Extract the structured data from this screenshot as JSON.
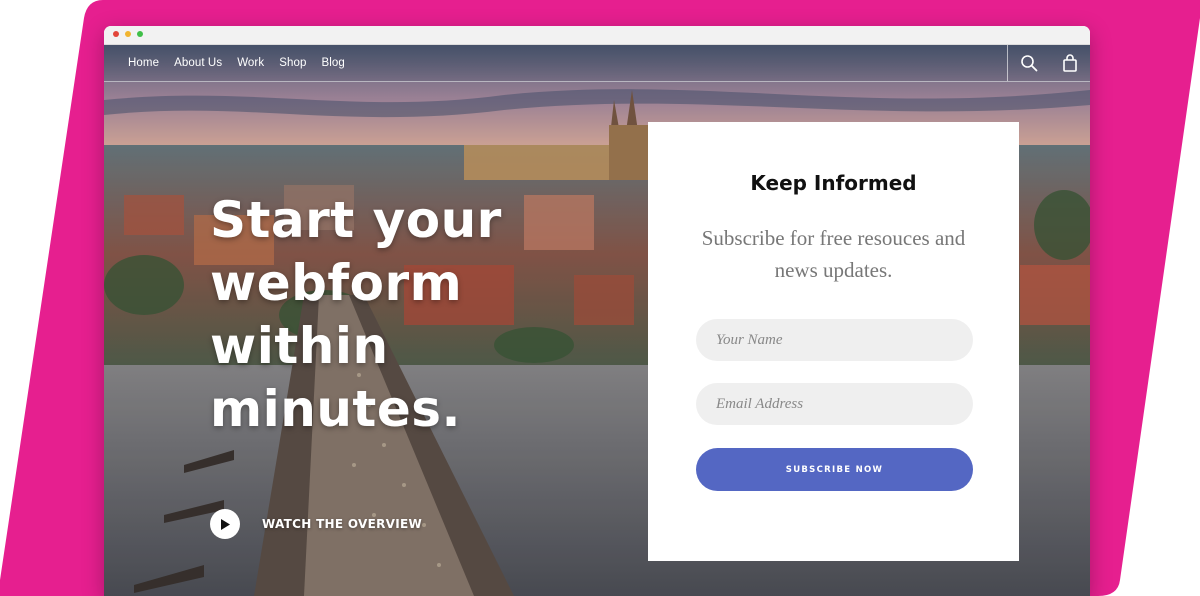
{
  "colors": {
    "backdrop": "#e61f8f",
    "accent": "#5467c3"
  },
  "nav": {
    "links": [
      "Home",
      "About Us",
      "Work",
      "Shop",
      "Blog"
    ],
    "icons": [
      "search-icon",
      "bag-icon"
    ]
  },
  "hero": {
    "title": "Start your webform within minutes.",
    "watch_label": "WATCH THE OVERVIEW"
  },
  "form": {
    "title": "Keep Informed",
    "subtitle": "Subscribe for free resouces and news updates.",
    "name_placeholder": "Your Name",
    "email_placeholder": "Email Address",
    "submit_label": "SUBSCRIBE NOW"
  }
}
